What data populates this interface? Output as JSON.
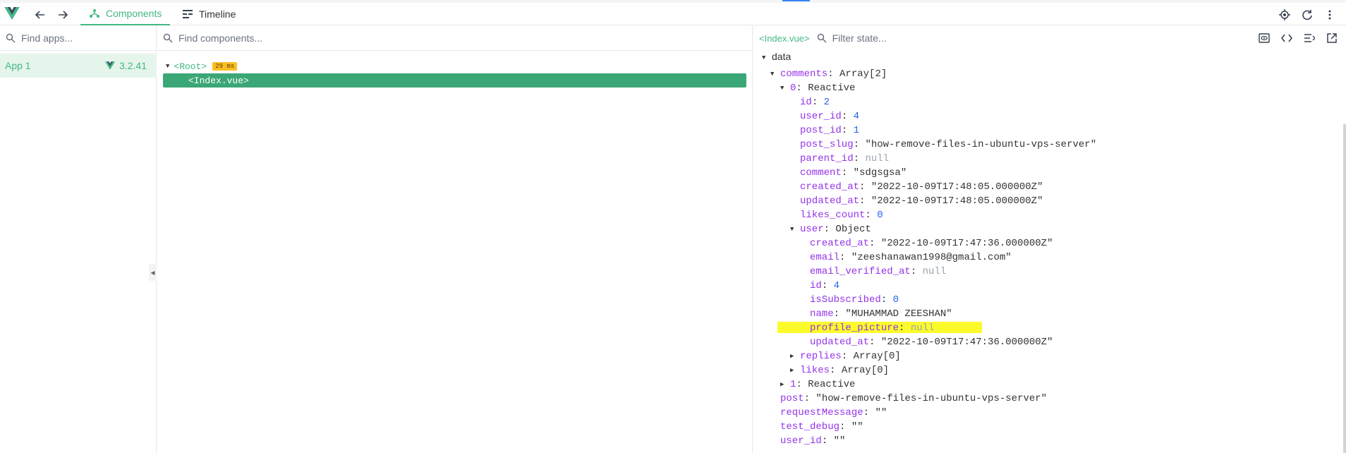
{
  "toolbar": {
    "tabs": [
      {
        "label": "Components",
        "active": true
      },
      {
        "label": "Timeline",
        "active": false
      }
    ]
  },
  "apps": {
    "search_placeholder": "Find apps...",
    "items": [
      {
        "name": "App 1",
        "version": "3.2.41"
      }
    ]
  },
  "tree": {
    "search_placeholder": "Find components...",
    "root": {
      "label": "<Root>",
      "badge": "29 ms"
    },
    "selected": {
      "label": "<Index.vue>"
    }
  },
  "state": {
    "component": "<Index.vue>",
    "filter_placeholder": "Filter state...",
    "section": "data",
    "comments_key": "comments",
    "comments_type": "Array[2]",
    "item0_key": "0",
    "item0_type": "Reactive",
    "id_key": "id",
    "id_val": "2",
    "user_id_key": "user_id",
    "user_id_val": "4",
    "post_id_key": "post_id",
    "post_id_val": "1",
    "post_slug_key": "post_slug",
    "post_slug_val": "\"how-remove-files-in-ubuntu-vps-server\"",
    "parent_id_key": "parent_id",
    "parent_id_val": "null",
    "comment_key": "comment",
    "comment_val": "\"sdgsgsa\"",
    "created_at_key": "created_at",
    "created_at_val": "\"2022-10-09T17:48:05.000000Z\"",
    "updated_at_key": "updated_at",
    "updated_at_val": "\"2022-10-09T17:48:05.000000Z\"",
    "likes_count_key": "likes_count",
    "likes_count_val": "0",
    "user_key": "user",
    "user_type": "Object",
    "u_created_at_key": "created_at",
    "u_created_at_val": "\"2022-10-09T17:47:36.000000Z\"",
    "u_email_key": "email",
    "u_email_val": "\"zeeshanawan1998@gmail.com\"",
    "u_email_verified_at_key": "email_verified_at",
    "u_email_verified_at_val": "null",
    "u_id_key": "id",
    "u_id_val": "4",
    "u_isSubscribed_key": "isSubscribed",
    "u_isSubscribed_val": "0",
    "u_name_key": "name",
    "u_name_val": "\"MUHAMMAD ZEESHAN\"",
    "u_profile_picture_key": "profile_picture",
    "u_profile_picture_val": "null",
    "u_updated_at_key": "updated_at",
    "u_updated_at_val": "\"2022-10-09T17:47:36.000000Z\"",
    "replies_key": "replies",
    "replies_type": "Array[0]",
    "likes_key": "likes",
    "likes_type": "Array[0]",
    "item1_key": "1",
    "item1_type": "Reactive",
    "post_key": "post",
    "post_val": "\"how-remove-files-in-ubuntu-vps-server\"",
    "requestMessage_key": "requestMessage",
    "requestMessage_val": "\"\"",
    "test_debug_key": "test_debug",
    "test_debug_val": "\"\"",
    "root_user_id_key": "user_id",
    "root_user_id_val": "\"\""
  },
  "colors": {
    "accent": "#42b883",
    "selected_row": "#3ba776",
    "badge": "#fbbf24",
    "highlight": "#fbfb2c",
    "key": "#9333ea",
    "number": "#2563eb"
  }
}
